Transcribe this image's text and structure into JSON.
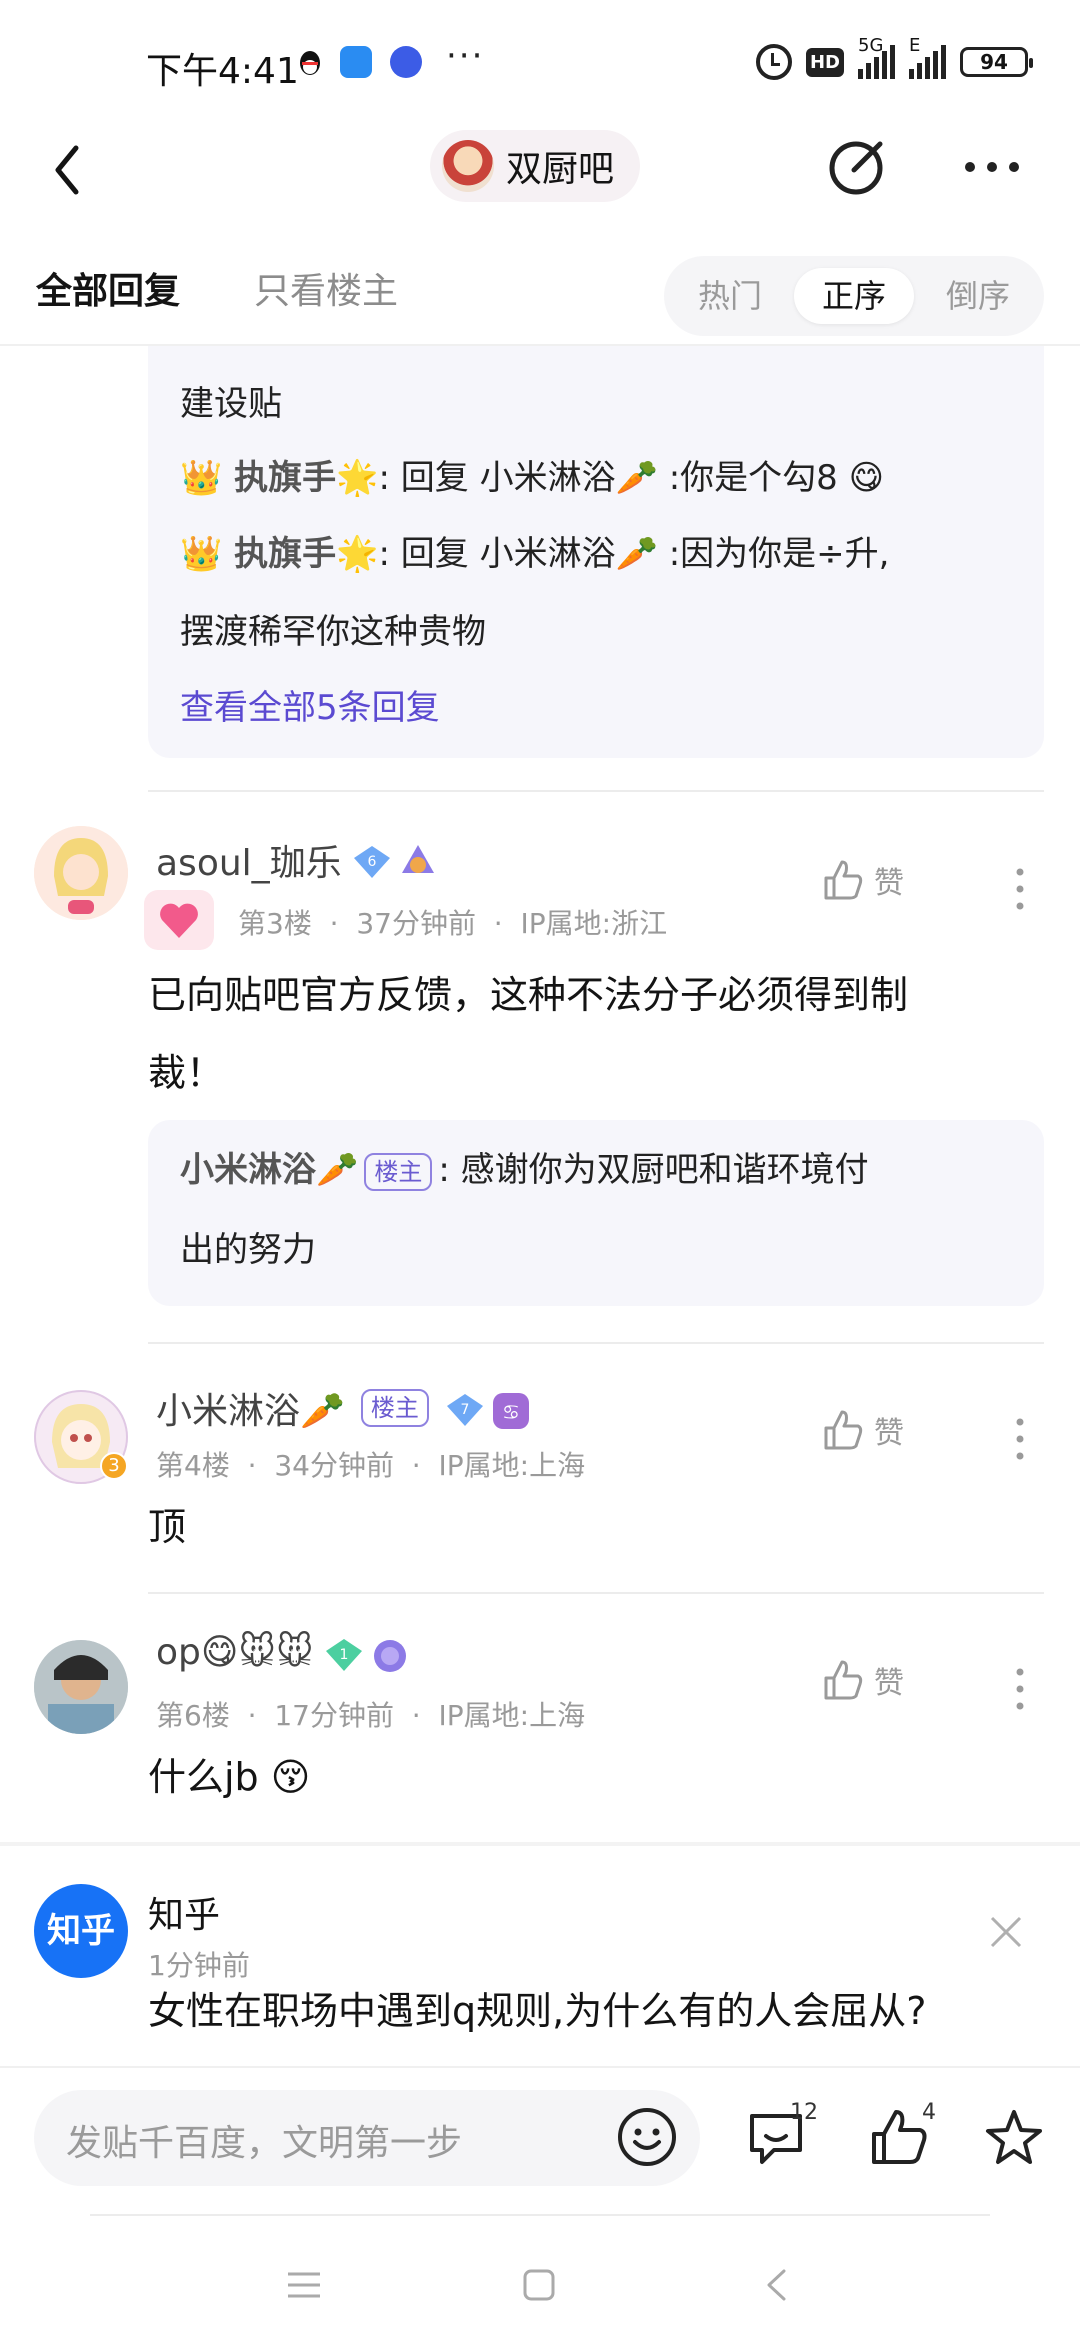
{
  "status_bar": {
    "time": "下午4:41",
    "network": "5G",
    "network2": "E",
    "battery": "94"
  },
  "header": {
    "forum_name": "双厨吧"
  },
  "tabs": {
    "all_replies": "全部回复",
    "op_only": "只看楼主",
    "sort": [
      "热门",
      "正序",
      "倒序"
    ],
    "sort_selected": "正序"
  },
  "floor2_replies": {
    "line1": "建设贴",
    "reply1_name": "👑 执旗手🌟",
    "reply1_text": ": 回复 小米淋浴🥕 :你是个勾8 😋",
    "reply2_name": "👑 执旗手🌟",
    "reply2_text": ": 回复 小米淋浴🥕 :因为你是÷升,",
    "reply2_cont": "摆渡稀罕你这种贵物",
    "view_all": "查看全部5条回复"
  },
  "floors": [
    {
      "username": "asoul_珈乐",
      "level": "6",
      "floor": "第3楼",
      "time": "37分钟前",
      "ip": "IP属地:浙江",
      "like_label": "赞",
      "content_line1": "已向贴吧官方反馈，这种不法分子必须得到制",
      "content_line2": "裁！",
      "sub_reply": {
        "name": "小米淋浴🥕",
        "tag": "楼主",
        "text_line1": ": 感谢你为双厨吧和谐环境付",
        "text_line2": "出的努力"
      }
    },
    {
      "username": "小米淋浴🥕",
      "tag": "楼主",
      "level": "7",
      "avatar_badge": "3",
      "floor": "第4楼",
      "time": "34分钟前",
      "ip": "IP属地:上海",
      "like_label": "赞",
      "content": "顶"
    },
    {
      "username": "op😋🐭🐭",
      "level": "1",
      "floor": "第6楼",
      "time": "17分钟前",
      "ip": "IP属地:上海",
      "like_label": "赞",
      "content": "什么jb 😚"
    }
  ],
  "ad": {
    "avatar_text": "知乎",
    "name": "知乎",
    "time": "1分钟前",
    "title": "女性在职场中遇到q规则,为什么有的人会屈从?"
  },
  "bottom_bar": {
    "composer_placeholder": "发贴千百度，文明第一步",
    "comment_count": "12",
    "like_count": "4"
  },
  "colors": {
    "accent": "#5b4ad1",
    "reply_bg": "#f6f6fb",
    "meta_gray": "#9a9a9a"
  }
}
